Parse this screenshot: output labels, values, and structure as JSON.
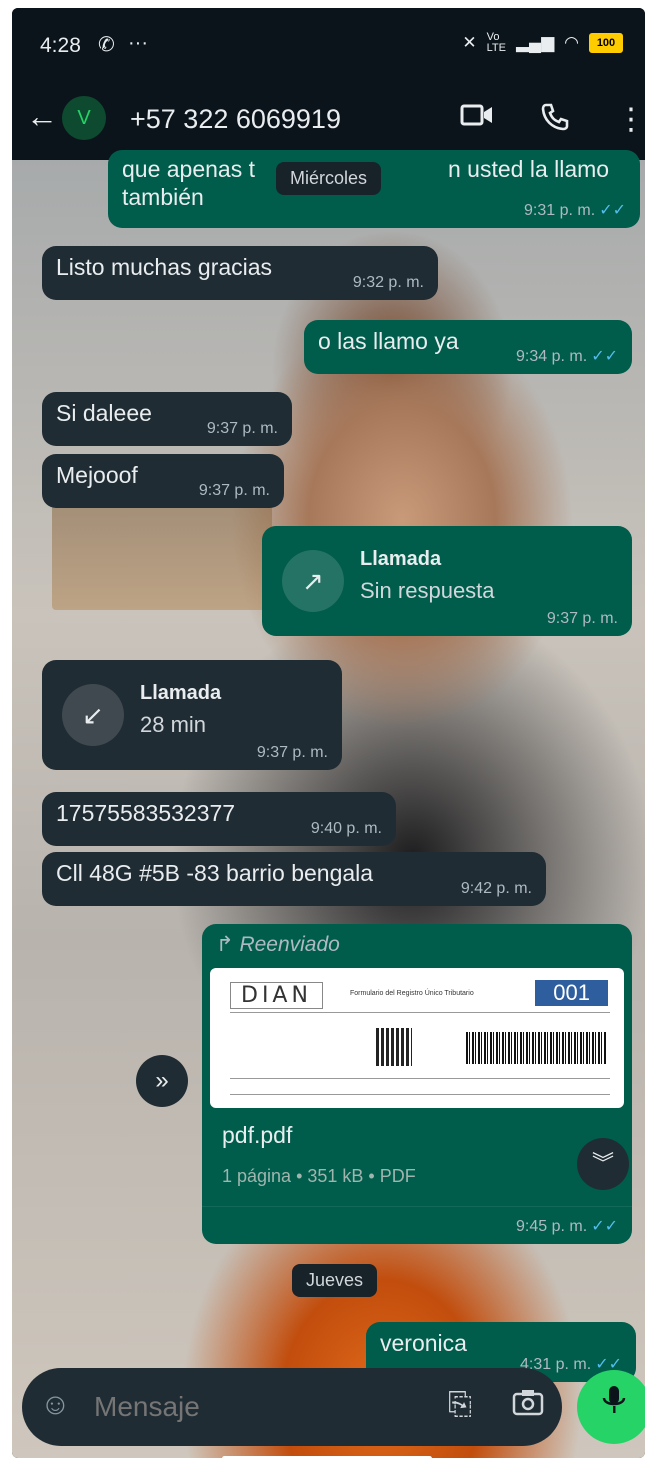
{
  "status_bar": {
    "time": "4:28",
    "battery": "100"
  },
  "header": {
    "avatar_letter": "V",
    "contact": "+57 322 6069919"
  },
  "day_labels": {
    "wednesday": "Miércoles",
    "thursday": "Jueves"
  },
  "messages": [
    {
      "dir": "out",
      "text": "que apenas t",
      "text2": "n usted la llamo",
      "text3": "también",
      "time": "9:31 p. m."
    },
    {
      "dir": "in",
      "text": "Listo muchas gracias",
      "time": "9:32 p. m."
    },
    {
      "dir": "out",
      "text": "o las llamo ya",
      "time": "9:34 p. m."
    },
    {
      "dir": "in",
      "text": "Si daleee",
      "time": "9:37 p. m."
    },
    {
      "dir": "in",
      "text": "Mejooof",
      "time": "9:37 p. m."
    },
    {
      "dir": "out",
      "type": "call",
      "title": "Llamada",
      "subtitle": "Sin respuesta",
      "time": "9:37 p. m."
    },
    {
      "dir": "in",
      "type": "call",
      "title": "Llamada",
      "subtitle": "28 min",
      "time": "9:37 p. m."
    },
    {
      "dir": "in",
      "text": "17575583532377",
      "time": "9:40 p. m."
    },
    {
      "dir": "in",
      "text": "Cll 48G #5B -83 barrio bengala",
      "time": "9:42 p. m."
    },
    {
      "dir": "out",
      "type": "document",
      "forwarded_label": "Reenviado",
      "file_name": "pdf.pdf",
      "file_meta": "1 página • 351 kB • PDF",
      "time": "9:45 p. m.",
      "preview": {
        "logo": "DIAN",
        "form_title": "Formulario del Registro Único Tributario",
        "form_number": "001"
      }
    },
    {
      "dir": "out",
      "text": "veronica",
      "time": "4:31 p. m."
    }
  ],
  "input": {
    "placeholder": "Mensaje"
  },
  "colors": {
    "incoming": "#202c33",
    "outgoing": "#005c4b",
    "accent": "#25d366",
    "read_ticks": "#53bdeb"
  }
}
